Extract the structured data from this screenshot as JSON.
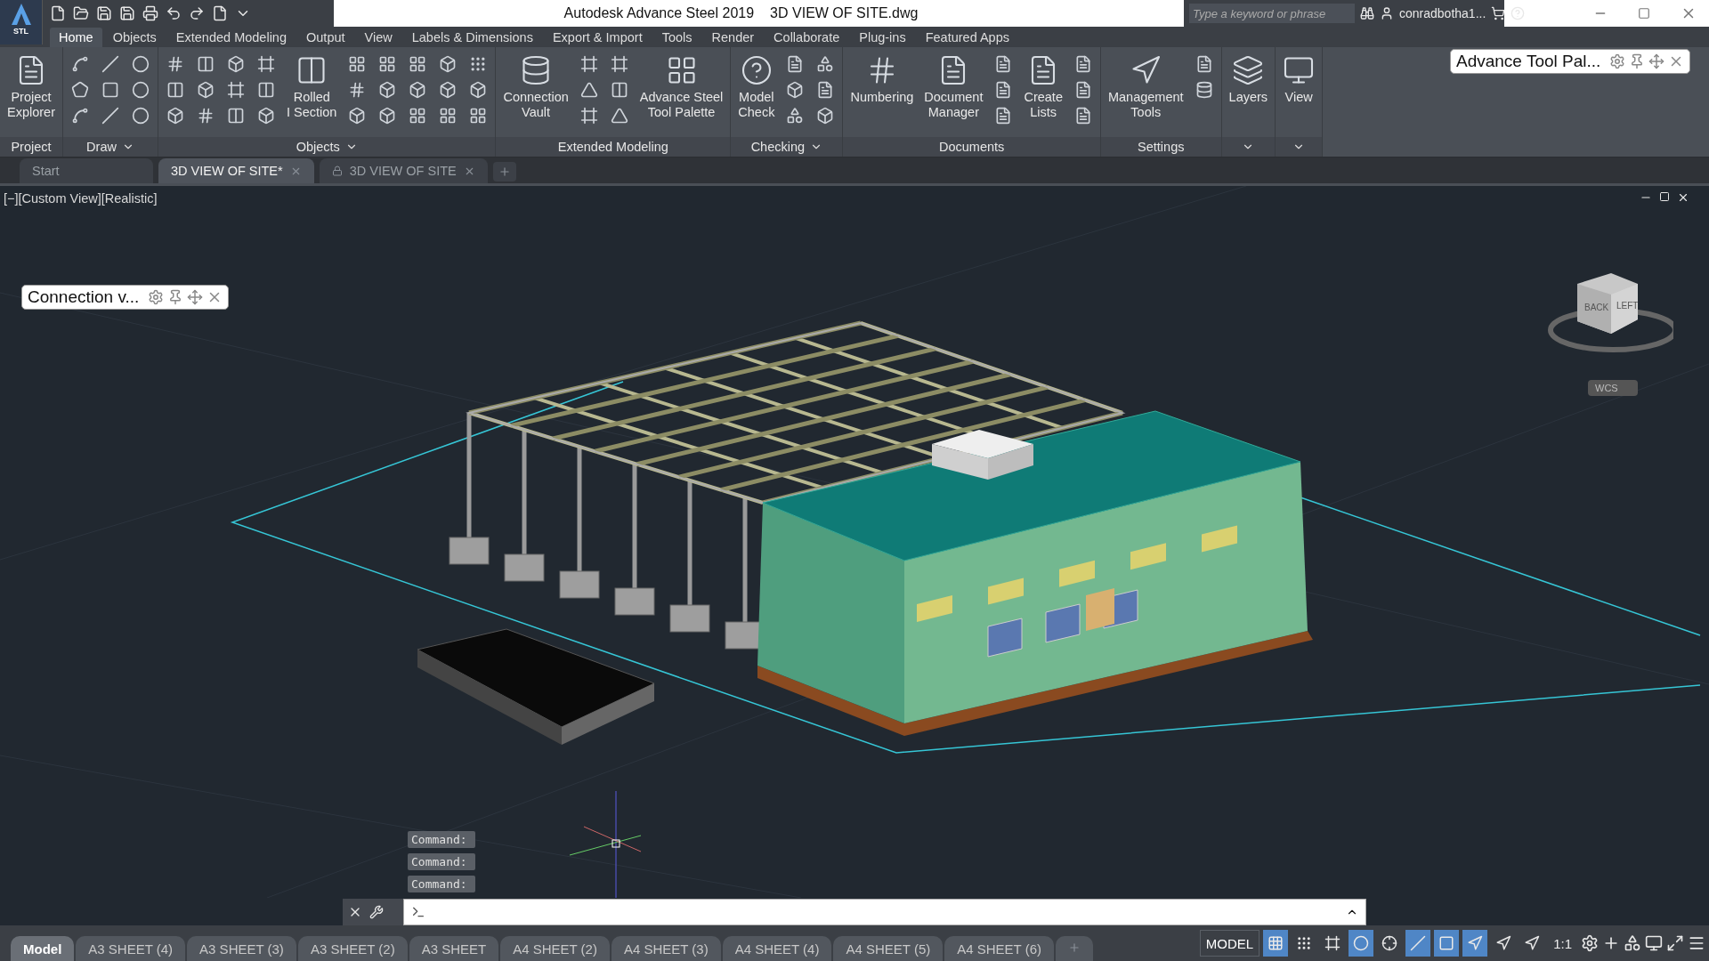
{
  "title_bar": {
    "app_badge": "STL",
    "app_name": "Autodesk Advance Steel 2019",
    "file_name": "3D VIEW OF SITE.dwg",
    "search": {
      "placeholder": "Type a keyword or phrase"
    },
    "user": "conradbotha1..."
  },
  "ribbon_tabs": [
    {
      "label": "Home",
      "selected": true
    },
    {
      "label": "Objects",
      "selected": false
    },
    {
      "label": "Extended Modeling",
      "selected": false
    },
    {
      "label": "Output",
      "selected": false
    },
    {
      "label": "View",
      "selected": false
    },
    {
      "label": "Labels & Dimensions",
      "selected": false
    },
    {
      "label": "Export & Import",
      "selected": false
    },
    {
      "label": "Tools",
      "selected": false
    },
    {
      "label": "Render",
      "selected": false
    },
    {
      "label": "Collaborate",
      "selected": false
    },
    {
      "label": "Plug-ins",
      "selected": false
    },
    {
      "label": "Featured Apps",
      "selected": false
    }
  ],
  "ribbon_panels": [
    {
      "title": "Project",
      "expandable": false,
      "items": [
        {
          "kind": "large",
          "label": "Project\nExplorer"
        }
      ]
    },
    {
      "title": "Draw",
      "expandable": true,
      "items": [
        {
          "kind": "icons"
        }
      ]
    },
    {
      "title": "Objects",
      "expandable": true,
      "items": [
        {
          "kind": "icons"
        },
        {
          "kind": "large",
          "label": "Rolled\nI Section"
        },
        {
          "kind": "icons"
        }
      ]
    },
    {
      "title": "Extended Modeling",
      "expandable": false,
      "items": [
        {
          "kind": "large",
          "label": "Connection\nVault"
        },
        {
          "kind": "icons"
        },
        {
          "kind": "large",
          "label": "Advance Steel\nTool Palette"
        }
      ]
    },
    {
      "title": "Checking",
      "expandable": true,
      "items": [
        {
          "kind": "large",
          "label": "Model\nCheck"
        },
        {
          "kind": "icons"
        }
      ]
    },
    {
      "title": "Documents",
      "expandable": false,
      "items": [
        {
          "kind": "large",
          "label": "Numbering"
        },
        {
          "kind": "large",
          "label": "Document\nManager"
        },
        {
          "kind": "icons"
        },
        {
          "kind": "large",
          "label": "Create\nLists"
        },
        {
          "kind": "icons"
        }
      ]
    },
    {
      "title": "Settings",
      "expandable": false,
      "items": [
        {
          "kind": "large",
          "label": "Management\nTools"
        },
        {
          "kind": "icons"
        }
      ]
    },
    {
      "expandable": true,
      "items": [
        {
          "kind": "large",
          "label": "Layers"
        }
      ]
    },
    {
      "expandable": true,
      "items": [
        {
          "kind": "large",
          "label": "View"
        }
      ]
    }
  ],
  "doc_tabs": [
    {
      "label": "Start",
      "selected": false,
      "locked": false,
      "closable": false
    },
    {
      "label": "3D VIEW OF SITE*",
      "selected": true,
      "locked": false,
      "closable": true
    },
    {
      "label": "3D VIEW OF SITE",
      "selected": false,
      "locked": true,
      "closable": true
    }
  ],
  "viewport": {
    "label": "[−][Custom View][Realistic]",
    "viewcube": {
      "faces": [
        "BACK",
        "LEFT"
      ],
      "ucs": "WCS"
    }
  },
  "palettes": [
    {
      "title": "Connection v..."
    },
    {
      "title": "Advance Tool Pal..."
    }
  ],
  "command_history": [
    "Command:",
    "Command:",
    "Command:"
  ],
  "layout_tabs": [
    {
      "label": "Model",
      "selected": true
    },
    {
      "label": "A3 SHEET (4)",
      "selected": false
    },
    {
      "label": "A3 SHEET (3)",
      "selected": false
    },
    {
      "label": "A3 SHEET (2)",
      "selected": false
    },
    {
      "label": "A3 SHEET",
      "selected": false
    },
    {
      "label": "A4 SHEET (2)",
      "selected": false
    },
    {
      "label": "A4 SHEET (3)",
      "selected": false
    },
    {
      "label": "A4 SHEET (4)",
      "selected": false
    },
    {
      "label": "A4 SHEET (5)",
      "selected": false
    },
    {
      "label": "A4 SHEET (6)",
      "selected": false
    }
  ],
  "status_bar": {
    "space": "MODEL",
    "scale": "1:1",
    "toggles": [
      {
        "on": true
      },
      {
        "on": false
      },
      {
        "on": false
      },
      {
        "on": true
      },
      {
        "on": false
      },
      {
        "on": true
      },
      {
        "on": true
      },
      {
        "on": true
      },
      {
        "on": false
      },
      {
        "on": false
      }
    ]
  }
}
